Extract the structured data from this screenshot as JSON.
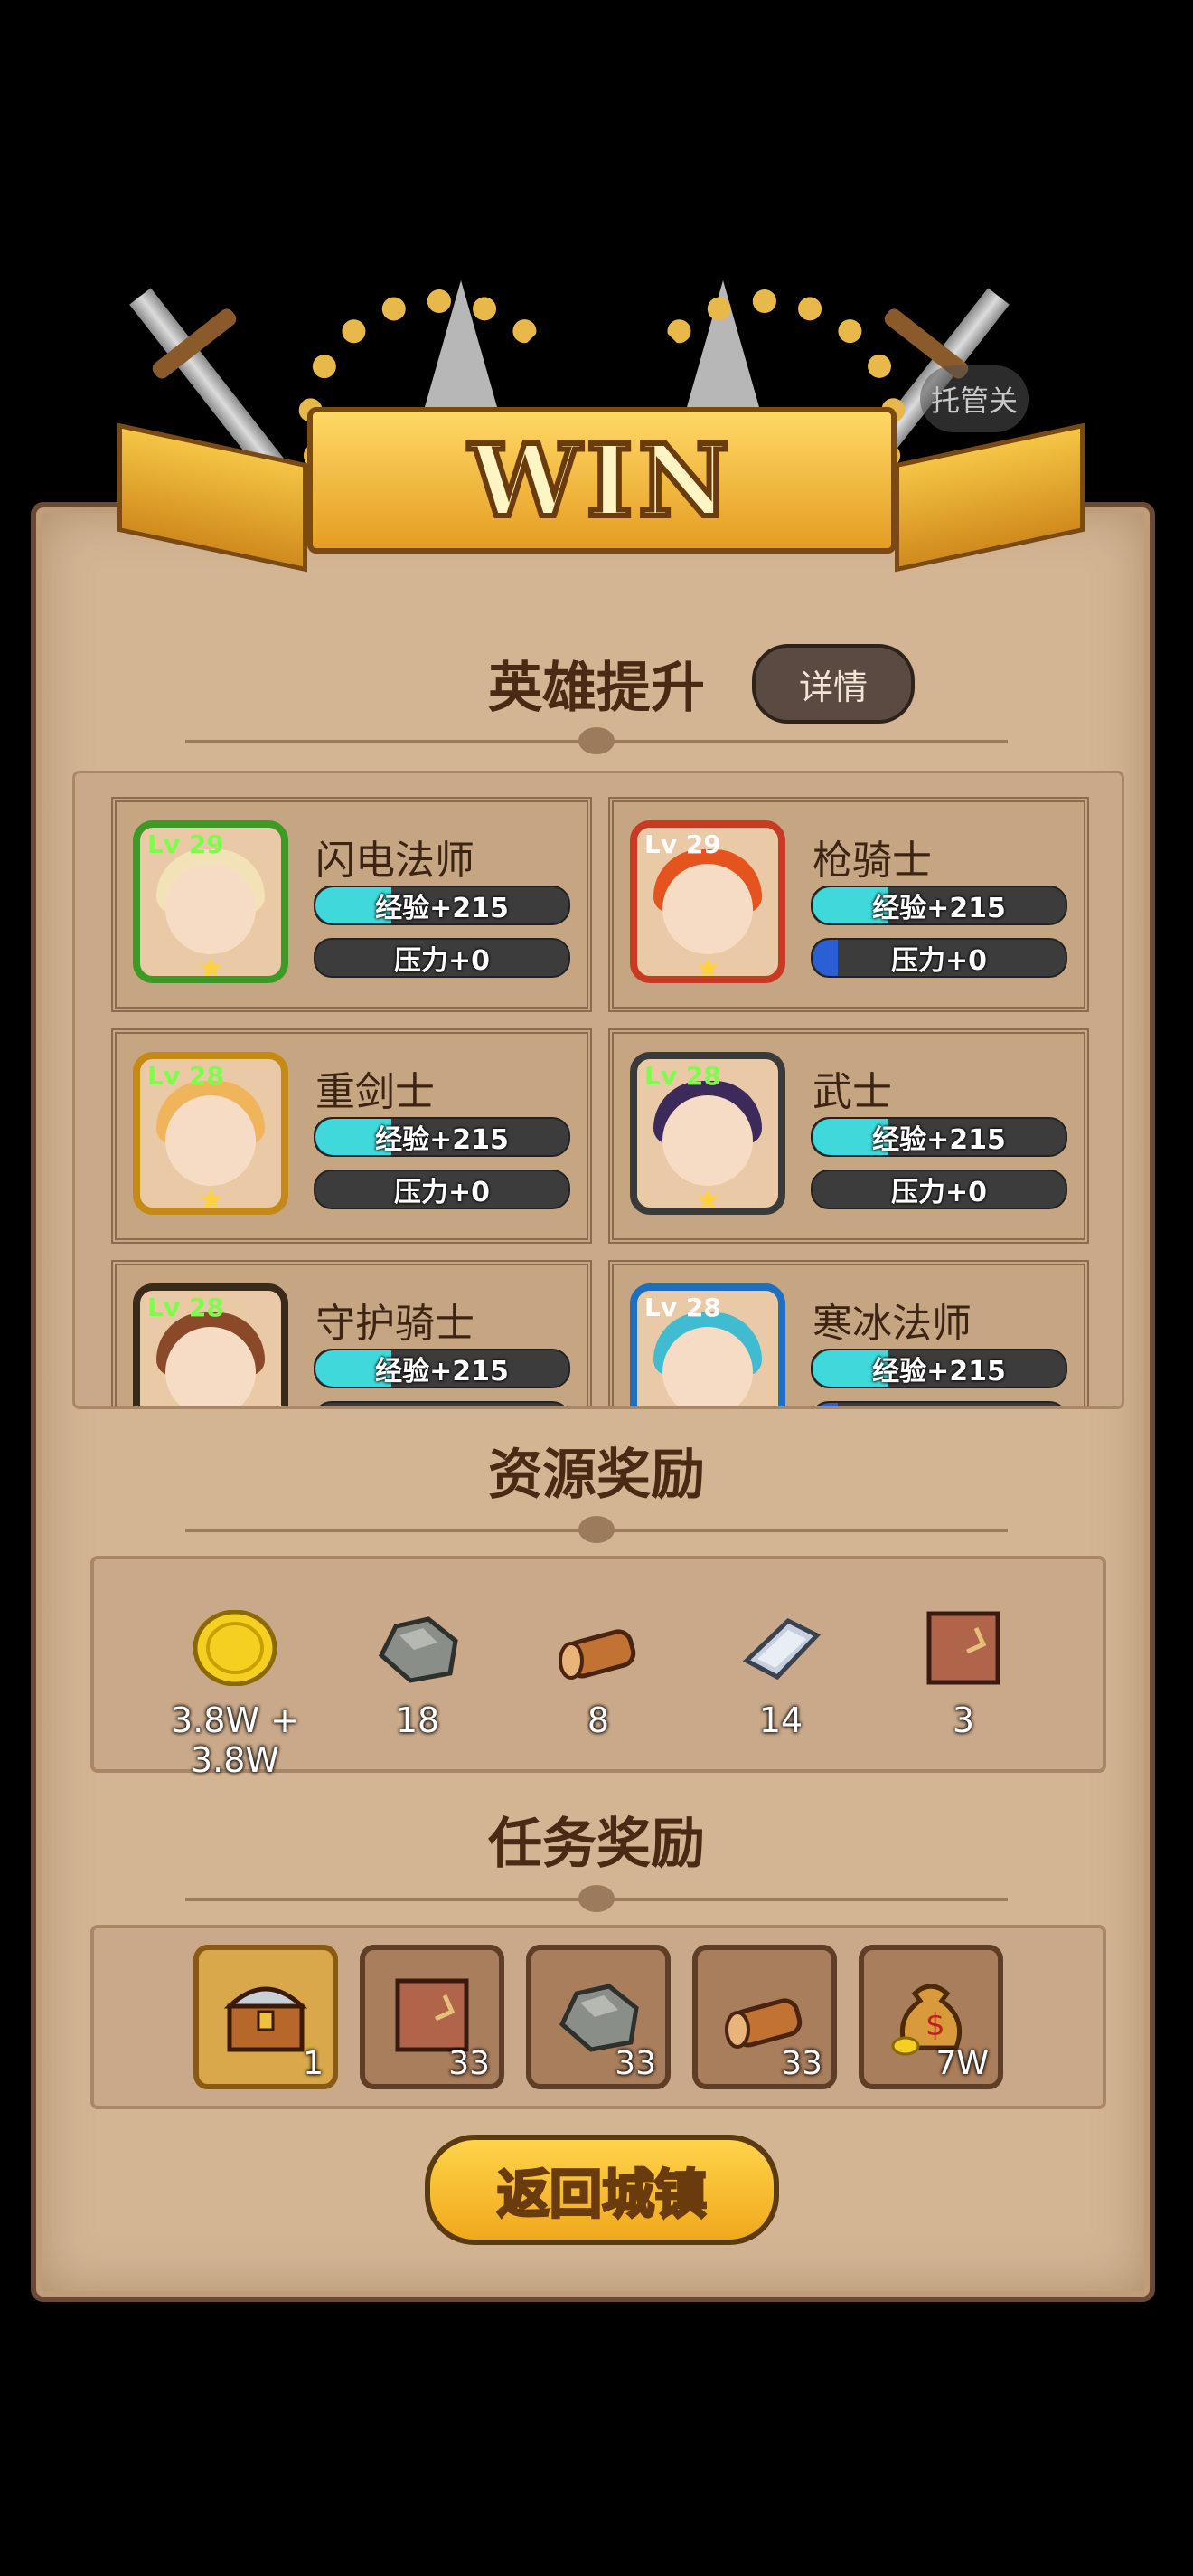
{
  "banner": {
    "title": "WIN"
  },
  "auto_button": {
    "label": "托管关"
  },
  "hero_section": {
    "title": "英雄提升",
    "details_label": "详情",
    "heroes": [
      {
        "name": "闪电法师",
        "level": "Lv 29",
        "exp": "经验+215",
        "pressure": "压力+0",
        "frame_color": "#3c9a25",
        "hair_color": "#f3e1b8",
        "lv_color": "#7cff4a"
      },
      {
        "name": "枪骑士",
        "level": "Lv 29",
        "exp": "经验+215",
        "pressure": "压力+0",
        "frame_color": "#c93a25",
        "hair_color": "#e5541f",
        "lv_color": "#ffffff"
      },
      {
        "name": "重剑士",
        "level": "Lv 28",
        "exp": "经验+215",
        "pressure": "压力+0",
        "frame_color": "#c58a16",
        "hair_color": "#f0b45a",
        "lv_color": "#7cff4a"
      },
      {
        "name": "武士",
        "level": "Lv 28",
        "exp": "经验+215",
        "pressure": "压力+0",
        "frame_color": "#3a3a3a",
        "hair_color": "#3b2a5a",
        "lv_color": "#7cff4a"
      },
      {
        "name": "守护骑士",
        "level": "Lv 28",
        "exp": "经验+215",
        "pressure": "",
        "frame_color": "#3a2a1a",
        "hair_color": "#8a4a2a",
        "lv_color": "#7cff4a"
      },
      {
        "name": "寒冰法师",
        "level": "Lv 28",
        "exp": "经验+215",
        "pressure": "",
        "frame_color": "#1f6fc0",
        "hair_color": "#3fbcd0",
        "lv_color": "#ffffff"
      }
    ],
    "exp_fill": 0.3,
    "pressure_fill_lancer": 0.1
  },
  "resource_section": {
    "title": "资源奖励",
    "items": [
      {
        "icon": "gold-coin-icon",
        "count": "3.8W + 3.8W"
      },
      {
        "icon": "stone-icon",
        "count": "18"
      },
      {
        "icon": "wood-log-icon",
        "count": "8"
      },
      {
        "icon": "iron-ingot-icon",
        "count": "14"
      },
      {
        "icon": "leather-icon",
        "count": "3"
      }
    ]
  },
  "task_section": {
    "title": "任务奖励",
    "items": [
      {
        "icon": "treasure-chest-icon",
        "count": "1"
      },
      {
        "icon": "leather-icon",
        "count": "33"
      },
      {
        "icon": "stone-icon",
        "count": "33"
      },
      {
        "icon": "wood-log-icon",
        "count": "33"
      },
      {
        "icon": "money-bag-icon",
        "count": "7W"
      }
    ]
  },
  "return_button": {
    "label": "返回城镇"
  },
  "colors": {
    "exp_bar": "#3fd9dc",
    "pressure_bar": "#2a5fd6",
    "title_brown": "#4a2a14"
  }
}
